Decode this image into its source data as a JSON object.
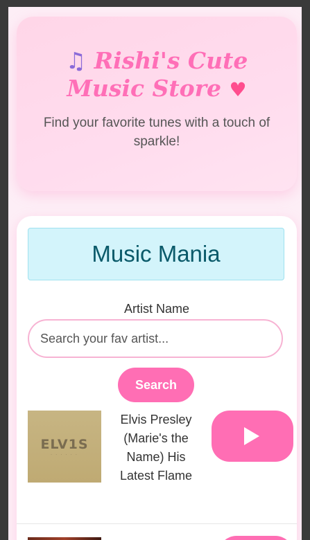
{
  "header": {
    "title": "Rishi's Cute Music Store",
    "note_icon": "musical-notes-icon",
    "heart_icon": "sparkling-heart-icon",
    "subtitle": "Find your favorite tunes with a touch of sparkle!"
  },
  "app": {
    "heading": "Music Mania",
    "artist_label": "Artist Name",
    "search_placeholder": "Search your fav artist...",
    "search_button": "Search"
  },
  "results": [
    {
      "title": "Elvis Presley (Marie's the Name) His Latest Flame",
      "album_art_text": "ELV1S",
      "action_icon": "play-icon"
    },
    {
      "action_icon": "play-icon"
    }
  ],
  "colors": {
    "accent_pink": "#ff6eb4",
    "heading_teal": "#0a5a6a",
    "heading_bg": "#d3f4fb"
  }
}
